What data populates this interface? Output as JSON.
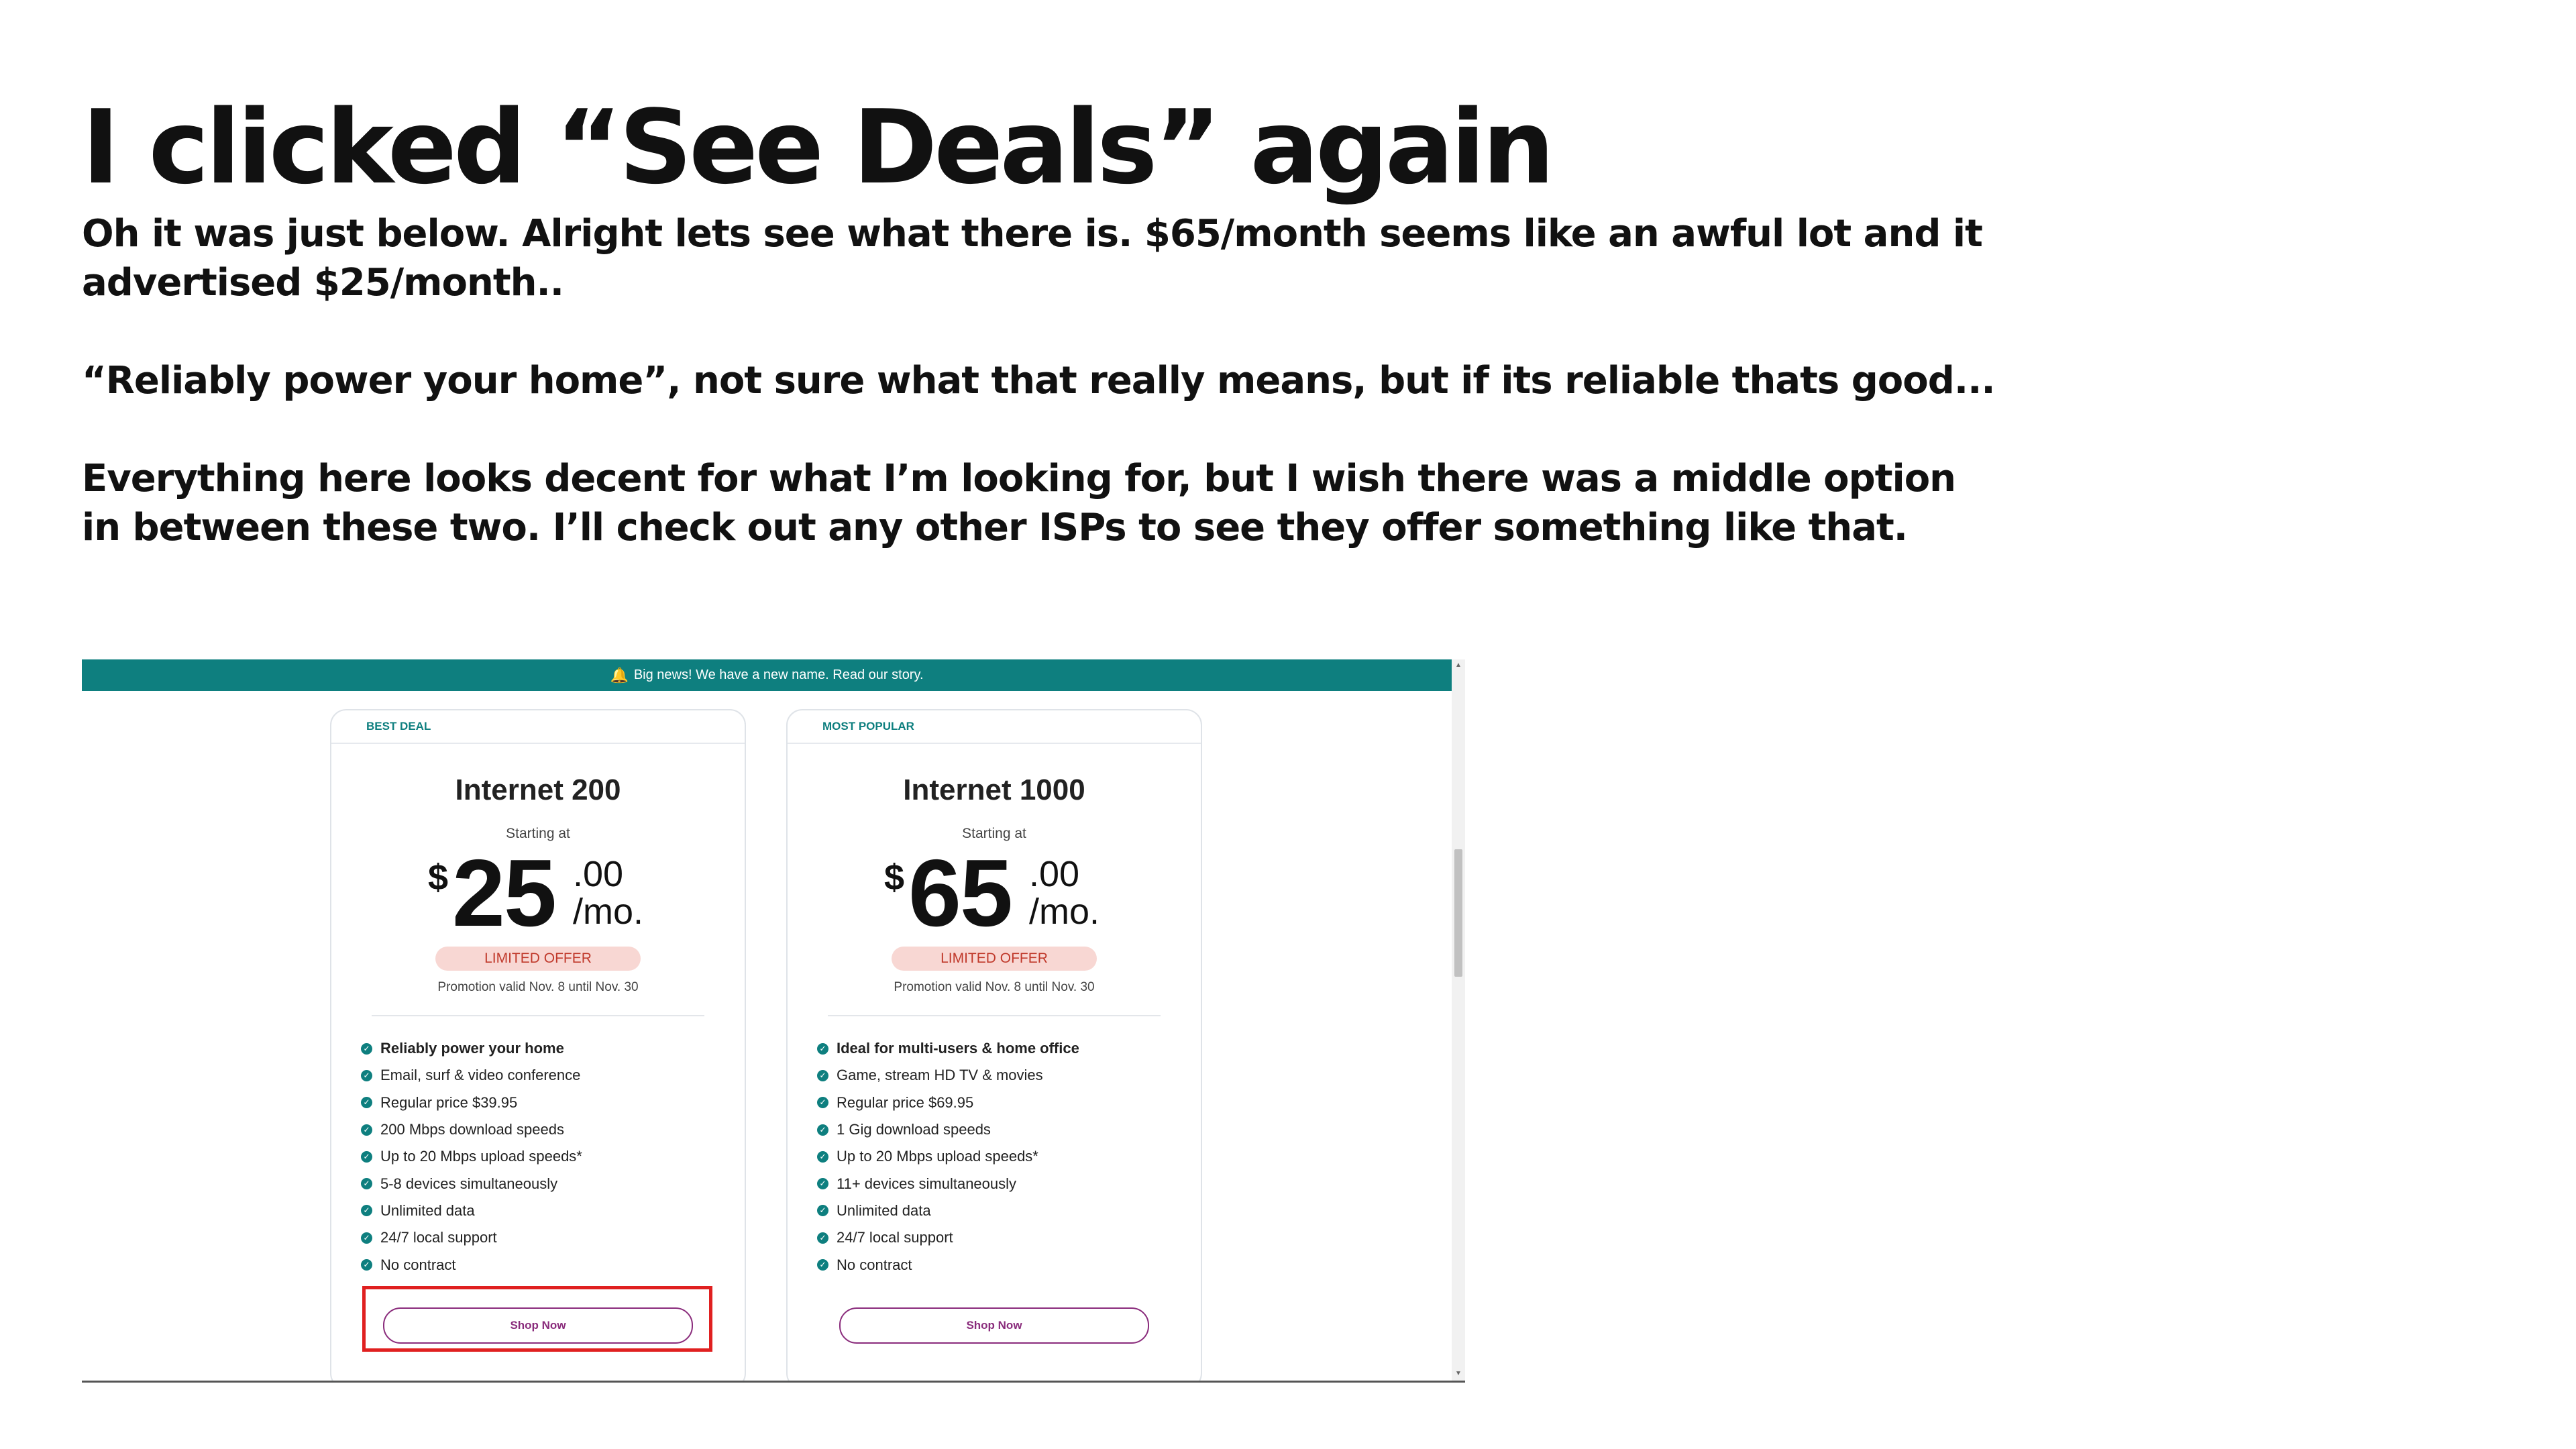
{
  "slide": {
    "title": "I clicked “See Deals” again",
    "paragraphs": [
      "Oh it was just below. Alright lets see what there is. $65/month seems like an awful lot and it advertised $25/month..",
      "“Reliably power your home”, not sure what that really means, but if its reliable thats good...",
      "Everything here looks decent for what I’m looking for, but I wish there was a middle option in between these two. I’ll check out any other ISPs to see they offer something like that."
    ]
  },
  "screenshot": {
    "banner_text": "Big news! We have a new name. Read our story.",
    "banner_icon": "bell-icon",
    "accent_color": "#0e7f7f",
    "button_color": "#8a2c7c",
    "highlight_color": "#e02020",
    "cards": [
      {
        "tag": "BEST DEAL",
        "name": "Internet 200",
        "starting": "Starting at",
        "currency": "$",
        "amount": "25",
        "cents": ".00",
        "per": "/mo.",
        "badge": "LIMITED OFFER",
        "promo": "Promotion valid Nov. 8 until Nov. 30",
        "features": [
          "Reliably power your home",
          "Email, surf & video conference",
          "Regular price $39.95",
          "200 Mbps download speeds",
          "Up to 20 Mbps upload speeds*",
          "5-8 devices simultaneously",
          "Unlimited data",
          "24/7 local support",
          "No contract"
        ],
        "button": "Shop Now"
      },
      {
        "tag": "MOST POPULAR",
        "name": "Internet 1000",
        "starting": "Starting at",
        "currency": "$",
        "amount": "65",
        "cents": ".00",
        "per": "/mo.",
        "badge": "LIMITED OFFER",
        "promo": "Promotion valid Nov. 8 until Nov. 30",
        "features": [
          "Ideal for multi-users & home office",
          "Game, stream HD TV & movies",
          "Regular price $69.95",
          "1 Gig download speeds",
          "Up to 20 Mbps upload speeds*",
          "11+ devices simultaneously",
          "Unlimited data",
          "24/7 local support",
          "No contract"
        ],
        "button": "Shop Now"
      }
    ]
  }
}
